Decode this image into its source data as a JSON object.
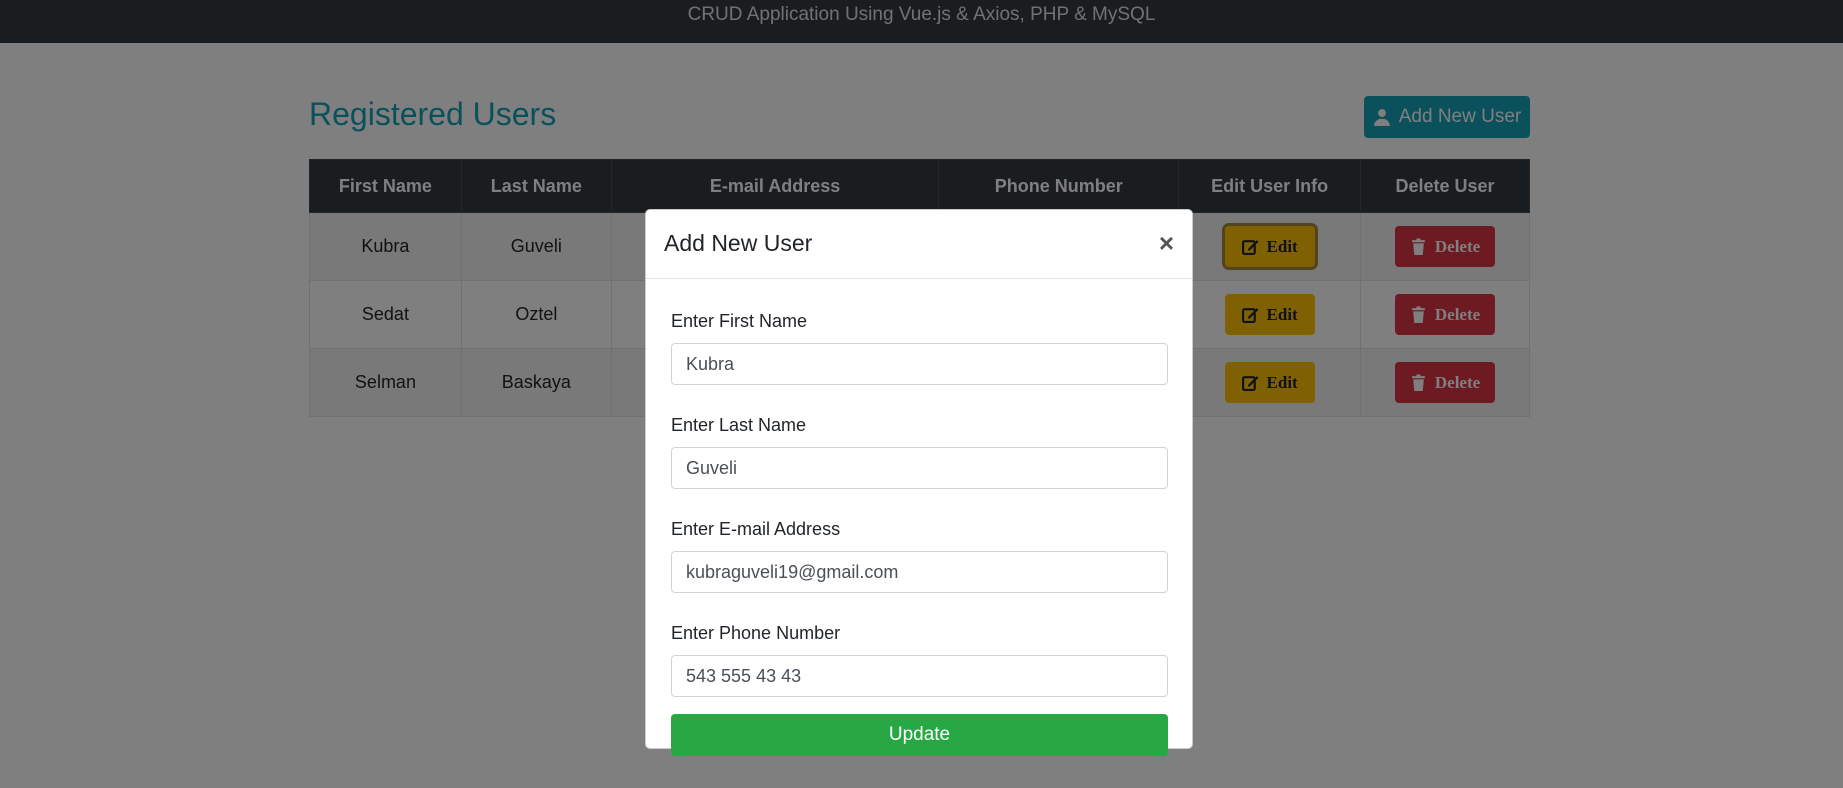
{
  "header": {
    "title": "CRUD Application Using Vue.js & Axios, PHP & MySQL"
  },
  "page": {
    "title": "Registered Users",
    "add_button_label": "Add New User",
    "add_button_icon": "user-icon"
  },
  "table": {
    "columns": [
      "First Name",
      "Last Name",
      "E-mail Address",
      "Phone Number",
      "Edit User Info",
      "Delete User"
    ],
    "rows": [
      {
        "first_name": "Kubra",
        "last_name": "Guveli",
        "edit_label": "Edit",
        "delete_label": "Delete"
      },
      {
        "first_name": "Sedat",
        "last_name": "Oztel",
        "edit_label": "Edit",
        "delete_label": "Delete"
      },
      {
        "first_name": "Selman",
        "last_name": "Baskaya",
        "edit_label": "Edit",
        "delete_label": "Delete"
      }
    ]
  },
  "modal": {
    "title": "Add New User",
    "close_glyph": "×",
    "fields": [
      {
        "label": "Enter First Name",
        "value": "Kubra"
      },
      {
        "label": "Enter Last Name",
        "value": "Guveli"
      },
      {
        "label": "Enter E-mail Address",
        "value": "kubraguveli19@gmail.com"
      },
      {
        "label": "Enter Phone Number",
        "value": "543 555 43 43"
      }
    ],
    "submit_label": "Update"
  },
  "colors": {
    "topbar": "#343a40",
    "accent": "#17a2b8",
    "edit": "#ffc107",
    "delete": "#dc3545",
    "update": "#28a745"
  }
}
